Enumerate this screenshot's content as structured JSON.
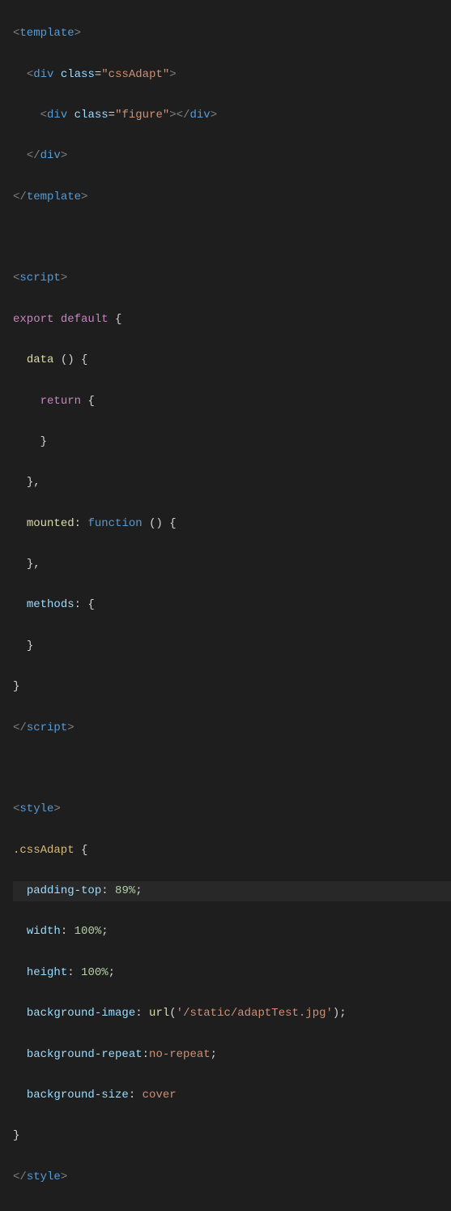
{
  "code": {
    "template": {
      "open": "template",
      "divOuter": {
        "tag": "div",
        "attr": "class",
        "val": "\"cssAdapt\""
      },
      "divInner": {
        "tag": "div",
        "attr": "class",
        "val": "\"figure\""
      },
      "divClose": "div",
      "close": "template"
    },
    "script": {
      "open": "script",
      "export": "export",
      "default": "default",
      "bracel": "{",
      "data": "data",
      "parens": "()",
      "return": "return",
      "mounted": "mounted",
      "function": "function",
      "methods": "methods",
      "close": "script"
    },
    "style": {
      "open": "style",
      "selector": ".cssAdapt",
      "props": {
        "paddingTop": {
          "name": "padding-top",
          "value": "89%"
        },
        "width": {
          "name": "width",
          "value": "100%"
        },
        "height": {
          "name": "height",
          "value": "100%"
        },
        "bgImage": {
          "name": "background-image",
          "urlfn": "url",
          "value": "'/static/adaptTest.jpg'"
        },
        "bgRepeat": {
          "name": "background-repeat",
          "value": "no-repeat"
        },
        "bgSize": {
          "name": "background-size",
          "value": "cover"
        }
      },
      "close": "style"
    }
  }
}
